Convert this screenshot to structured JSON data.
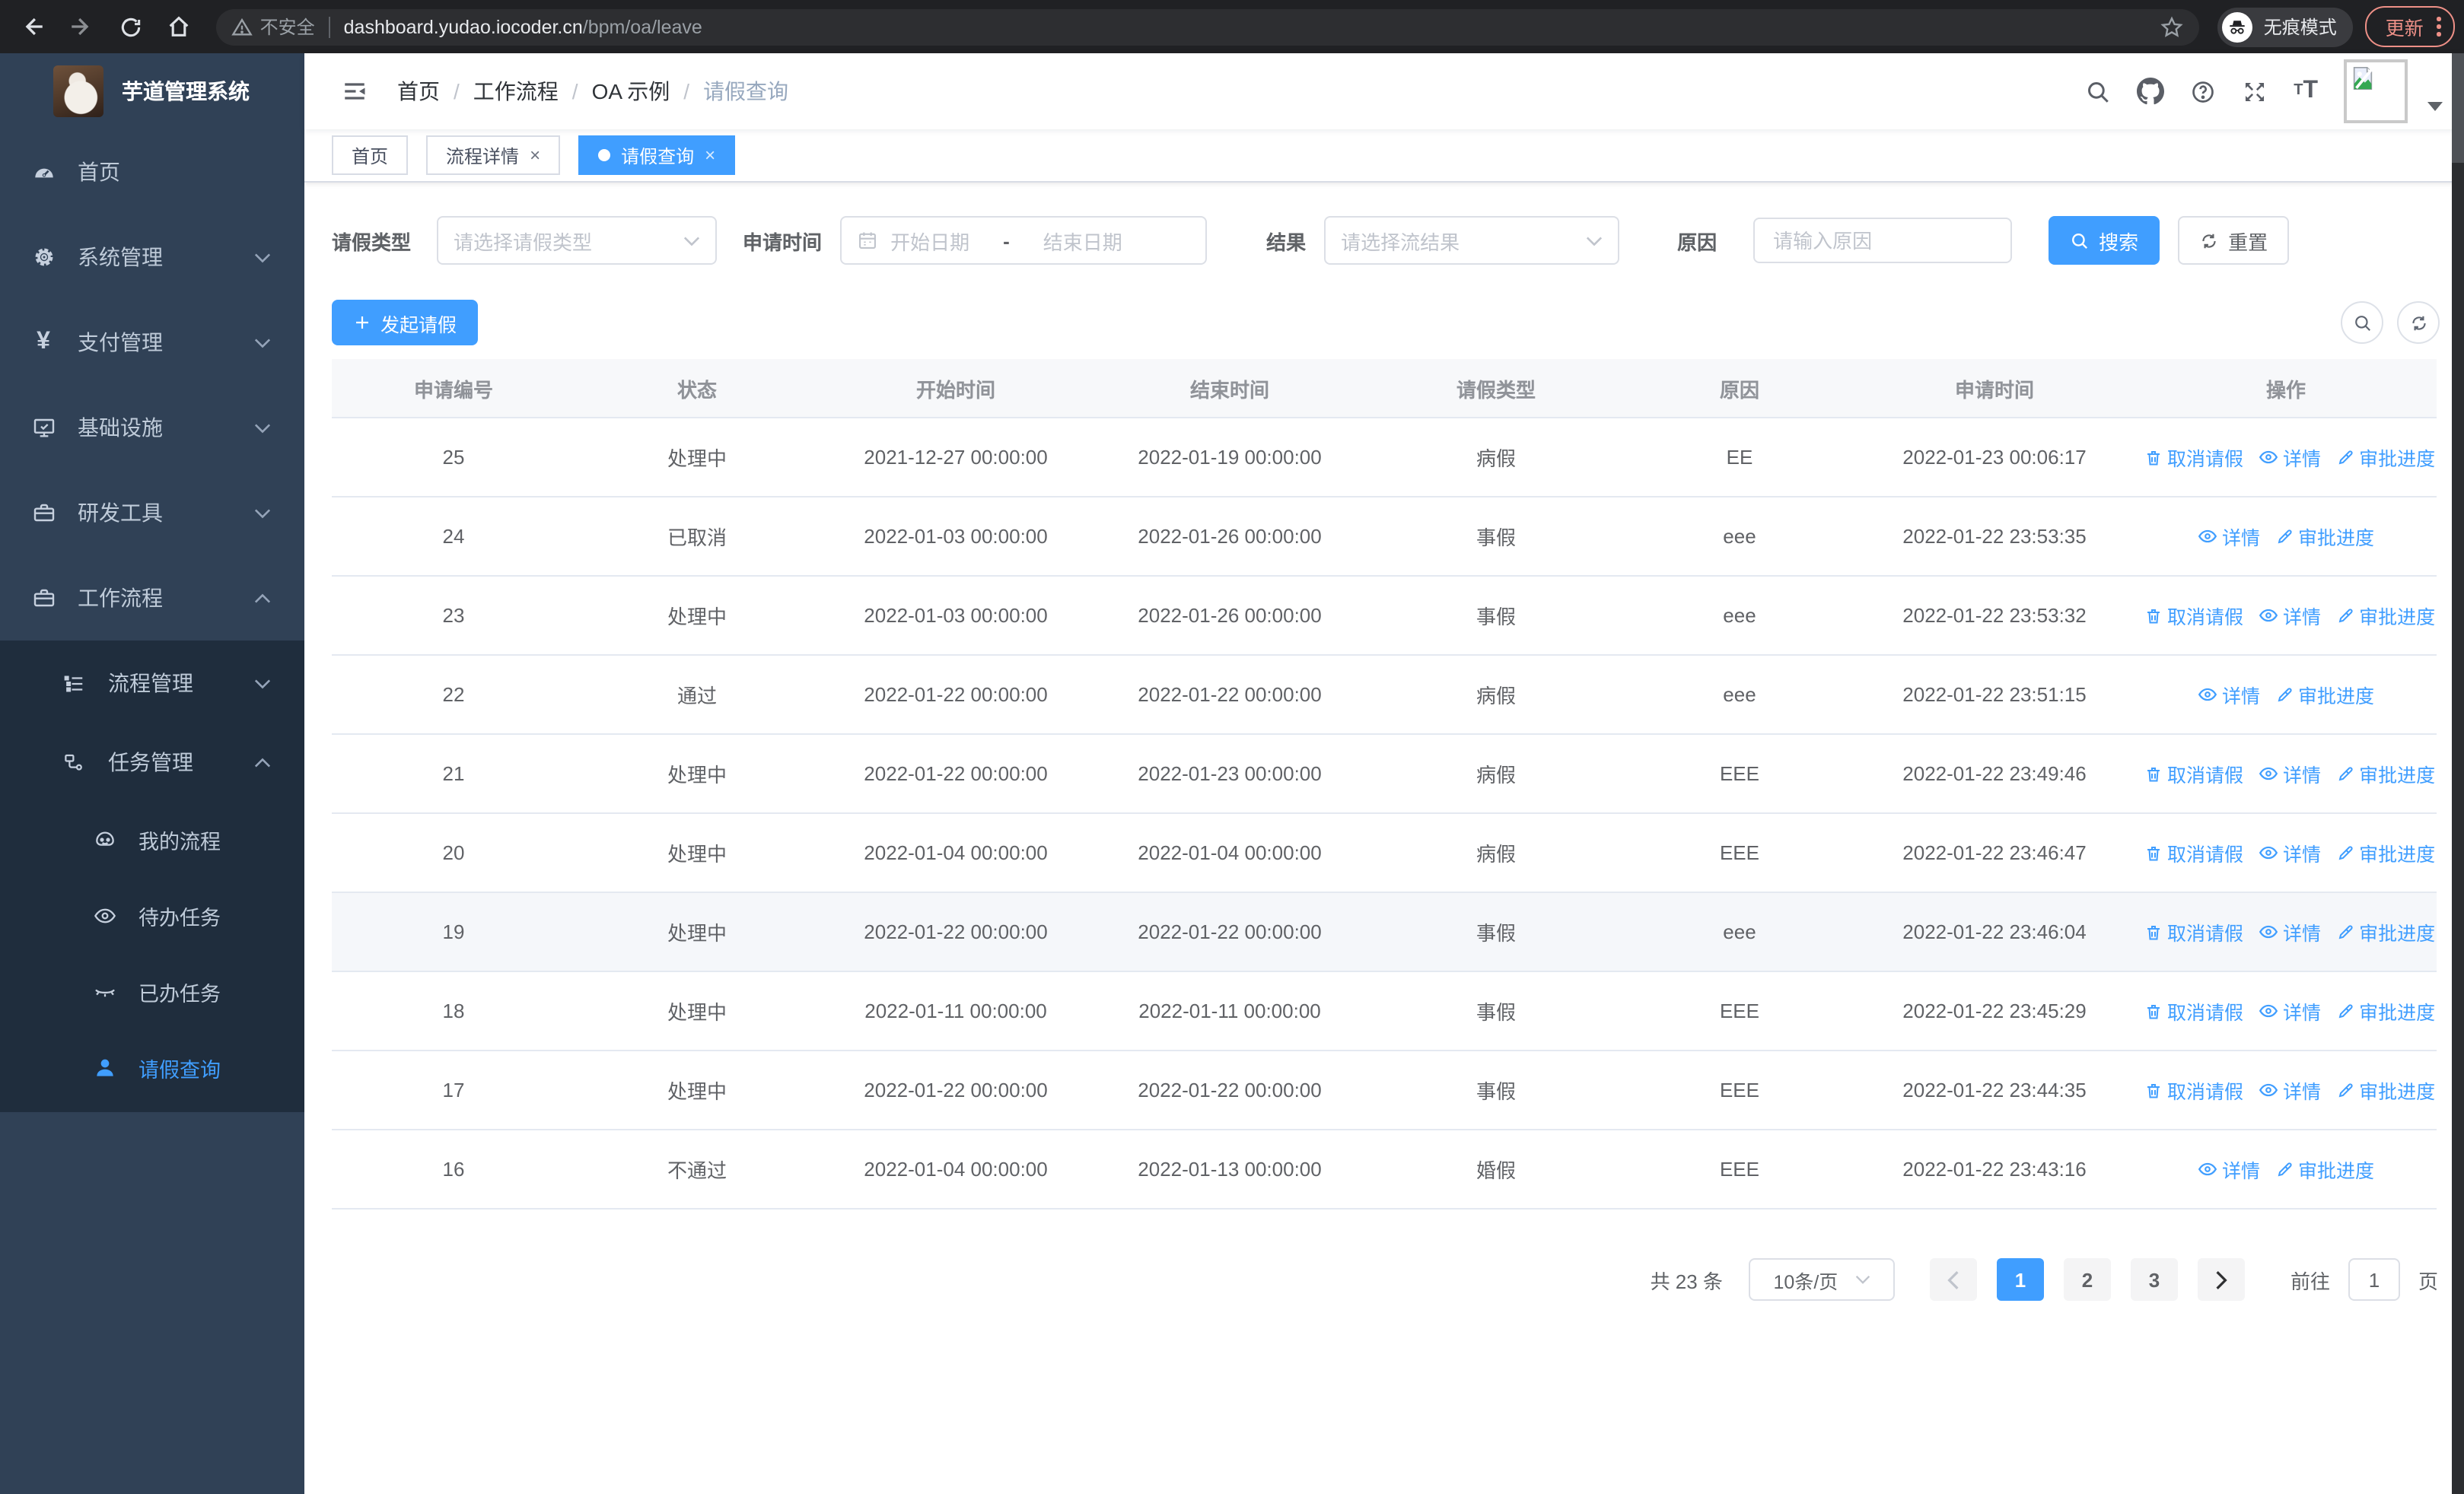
{
  "browser": {
    "security_label": "不安全",
    "url_domain": "dashboard.yudao.iocoder.cn",
    "url_path": "/bpm/oa/leave",
    "incognito_label": "无痕模式",
    "update_label": "更新"
  },
  "app": {
    "title": "芋道管理系统"
  },
  "sidebar": {
    "items": [
      {
        "label": "首页",
        "icon": "dashboard-icon"
      },
      {
        "label": "系统管理",
        "icon": "gear-icon"
      },
      {
        "label": "支付管理",
        "icon": "yen-icon"
      },
      {
        "label": "基础设施",
        "icon": "monitor-icon"
      },
      {
        "label": "研发工具",
        "icon": "toolbox-icon"
      },
      {
        "label": "工作流程",
        "icon": "briefcase-icon"
      },
      {
        "label": "流程管理",
        "icon": "tree-list-icon"
      },
      {
        "label": "任务管理",
        "icon": "flow-icon"
      },
      {
        "label": "我的流程",
        "icon": "robot-icon"
      },
      {
        "label": "待办任务",
        "icon": "eye-icon"
      },
      {
        "label": "已办任务",
        "icon": "eye-closed-icon"
      },
      {
        "label": "请假查询",
        "icon": "user-icon"
      }
    ]
  },
  "breadcrumb": [
    "首页",
    "工作流程",
    "OA 示例",
    "请假查询"
  ],
  "tabs": [
    {
      "label": "首页"
    },
    {
      "label": "流程详情"
    },
    {
      "label": "请假查询"
    }
  ],
  "filters": {
    "leave_type": {
      "label": "请假类型",
      "placeholder": "请选择请假类型"
    },
    "apply_time": {
      "label": "申请时间",
      "start_placeholder": "开始日期",
      "separator": "-",
      "end_placeholder": "结束日期"
    },
    "result": {
      "label": "结果",
      "placeholder": "请选择流结果"
    },
    "reason": {
      "label": "原因",
      "placeholder": "请输入原因"
    },
    "search_label": "搜索",
    "reset_label": "重置"
  },
  "toolbar": {
    "create_label": "发起请假"
  },
  "table": {
    "columns": [
      "申请编号",
      "状态",
      "开始时间",
      "结束时间",
      "请假类型",
      "原因",
      "申请时间",
      "操作"
    ],
    "action_labels": {
      "cancel": "取消请假",
      "detail": "详情",
      "progress": "审批进度"
    },
    "rows": [
      {
        "id": "25",
        "status": "处理中",
        "start": "2021-12-27 00:00:00",
        "end": "2022-01-19 00:00:00",
        "type": "病假",
        "reason": "EE",
        "applied": "2022-01-23 00:06:17",
        "actions": [
          "cancel",
          "detail",
          "progress"
        ],
        "highlighted": false
      },
      {
        "id": "24",
        "status": "已取消",
        "start": "2022-01-03 00:00:00",
        "end": "2022-01-26 00:00:00",
        "type": "事假",
        "reason": "eee",
        "applied": "2022-01-22 23:53:35",
        "actions": [
          "detail",
          "progress"
        ],
        "highlighted": false
      },
      {
        "id": "23",
        "status": "处理中",
        "start": "2022-01-03 00:00:00",
        "end": "2022-01-26 00:00:00",
        "type": "事假",
        "reason": "eee",
        "applied": "2022-01-22 23:53:32",
        "actions": [
          "cancel",
          "detail",
          "progress"
        ],
        "highlighted": false
      },
      {
        "id": "22",
        "status": "通过",
        "start": "2022-01-22 00:00:00",
        "end": "2022-01-22 00:00:00",
        "type": "病假",
        "reason": "eee",
        "applied": "2022-01-22 23:51:15",
        "actions": [
          "detail",
          "progress"
        ],
        "highlighted": false
      },
      {
        "id": "21",
        "status": "处理中",
        "start": "2022-01-22 00:00:00",
        "end": "2022-01-23 00:00:00",
        "type": "病假",
        "reason": "EEE",
        "applied": "2022-01-22 23:49:46",
        "actions": [
          "cancel",
          "detail",
          "progress"
        ],
        "highlighted": false
      },
      {
        "id": "20",
        "status": "处理中",
        "start": "2022-01-04 00:00:00",
        "end": "2022-01-04 00:00:00",
        "type": "病假",
        "reason": "EEE",
        "applied": "2022-01-22 23:46:47",
        "actions": [
          "cancel",
          "detail",
          "progress"
        ],
        "highlighted": false
      },
      {
        "id": "19",
        "status": "处理中",
        "start": "2022-01-22 00:00:00",
        "end": "2022-01-22 00:00:00",
        "type": "事假",
        "reason": "eee",
        "applied": "2022-01-22 23:46:04",
        "actions": [
          "cancel",
          "detail",
          "progress"
        ],
        "highlighted": true
      },
      {
        "id": "18",
        "status": "处理中",
        "start": "2022-01-11 00:00:00",
        "end": "2022-01-11 00:00:00",
        "type": "事假",
        "reason": "EEE",
        "applied": "2022-01-22 23:45:29",
        "actions": [
          "cancel",
          "detail",
          "progress"
        ],
        "highlighted": false
      },
      {
        "id": "17",
        "status": "处理中",
        "start": "2022-01-22 00:00:00",
        "end": "2022-01-22 00:00:00",
        "type": "事假",
        "reason": "EEE",
        "applied": "2022-01-22 23:44:35",
        "actions": [
          "cancel",
          "detail",
          "progress"
        ],
        "highlighted": false
      },
      {
        "id": "16",
        "status": "不通过",
        "start": "2022-01-04 00:00:00",
        "end": "2022-01-13 00:00:00",
        "type": "婚假",
        "reason": "EEE",
        "applied": "2022-01-22 23:43:16",
        "actions": [
          "detail",
          "progress"
        ],
        "highlighted": false
      }
    ]
  },
  "pagination": {
    "total_label": "共 23 条",
    "page_size": "10条/页",
    "pages": [
      "1",
      "2",
      "3"
    ],
    "active_page": "1",
    "goto_label": "前往",
    "goto_value": "1",
    "page_unit": "页"
  },
  "colors": {
    "primary": "#409eff",
    "sidebar_bg": "#304156",
    "submenu_bg": "#1f2d3d",
    "chrome_bg": "#202124",
    "update_accent": "#ee9087"
  }
}
